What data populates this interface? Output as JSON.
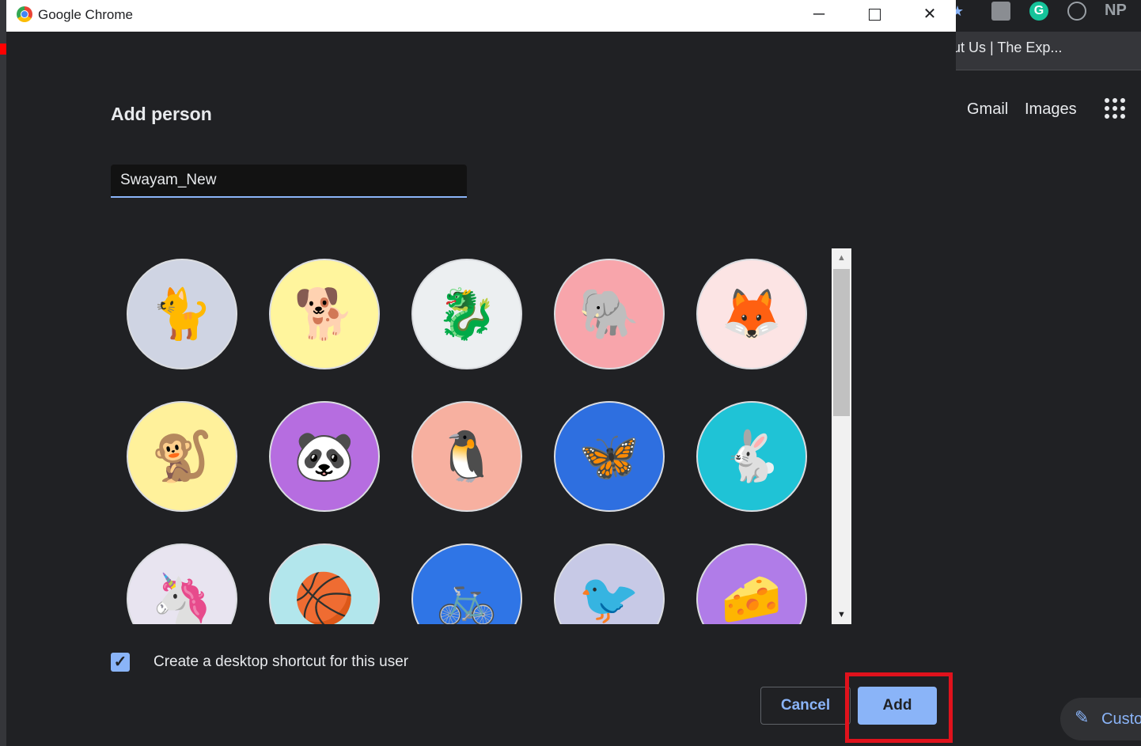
{
  "window": {
    "title": "Google Chrome",
    "controls": {
      "minimize": "─",
      "close": "✕"
    }
  },
  "dialog": {
    "heading": "Add person",
    "name_value": "Swayam_New",
    "avatars": [
      {
        "name": "avatar-cat",
        "emoji": "🐈",
        "bg": "#cfd4e3"
      },
      {
        "name": "avatar-corgi",
        "emoji": "🐕",
        "bg": "#fff59d"
      },
      {
        "name": "avatar-dragon",
        "emoji": "🐉",
        "bg": "#eceff1"
      },
      {
        "name": "avatar-elephant",
        "emoji": "🐘",
        "bg": "#f8a5ab"
      },
      {
        "name": "avatar-fox",
        "emoji": "🦊",
        "bg": "#fce4e4"
      },
      {
        "name": "avatar-monkey",
        "emoji": "🐒",
        "bg": "#fff19b"
      },
      {
        "name": "avatar-panda",
        "emoji": "🐼",
        "bg": "#b66de0"
      },
      {
        "name": "avatar-penguin",
        "emoji": "🐧",
        "bg": "#f7b0a0"
      },
      {
        "name": "avatar-butterfly",
        "emoji": "🦋",
        "bg": "#2e6fe0"
      },
      {
        "name": "avatar-rabbit",
        "emoji": "🐇",
        "bg": "#1fc3d6"
      },
      {
        "name": "avatar-unicorn",
        "emoji": "🦄",
        "bg": "#e8e4f0"
      },
      {
        "name": "avatar-basketball",
        "emoji": "🏀",
        "bg": "#b2e6ec"
      },
      {
        "name": "avatar-bicycle",
        "emoji": "🚲",
        "bg": "#2f75e6"
      },
      {
        "name": "avatar-bird",
        "emoji": "🐦",
        "bg": "#c7c9e6"
      },
      {
        "name": "avatar-cheese",
        "emoji": "🧀",
        "bg": "#b07ce8"
      }
    ],
    "scroll": {
      "up": "▲",
      "down": "▼"
    },
    "shortcut": {
      "checked": true,
      "check_glyph": "✓",
      "label": "Create a desktop shortcut for this user"
    },
    "cancel_label": "Cancel",
    "add_label": "Add"
  },
  "background_browser": {
    "bookmark_text": "out Us | The Exp...",
    "gmail": "Gmail",
    "images": "Images",
    "customize": "Custo",
    "extensions": {
      "grammarly": "G",
      "np": "NP"
    }
  }
}
